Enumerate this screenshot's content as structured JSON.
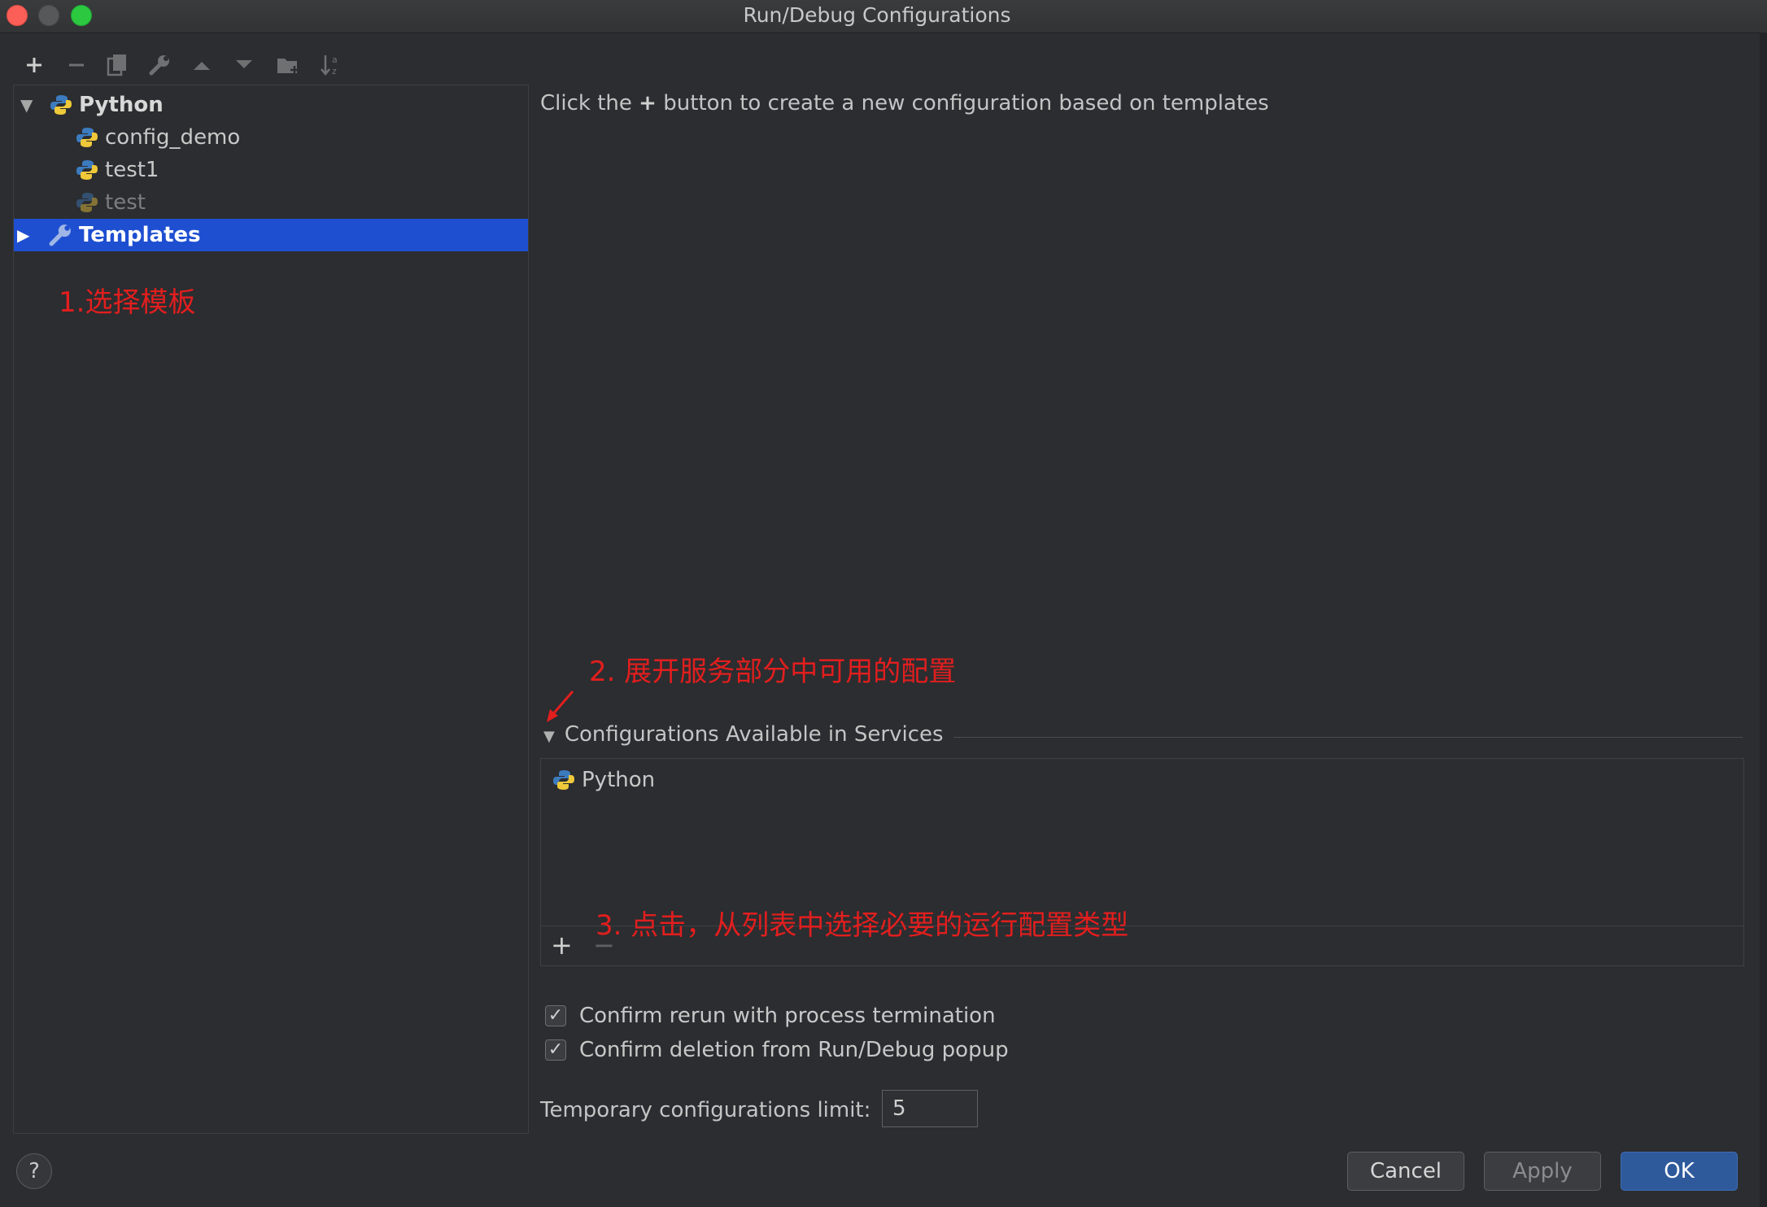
{
  "window": {
    "title": "Run/Debug Configurations"
  },
  "toolbar": {
    "buttons": [
      {
        "icon": "plus-icon",
        "enabled": true
      },
      {
        "icon": "minus-icon",
        "enabled": false
      },
      {
        "icon": "copy-icon",
        "enabled": false
      },
      {
        "icon": "wrench-icon",
        "enabled": false
      },
      {
        "icon": "arrow-up-icon",
        "enabled": false
      },
      {
        "icon": "arrow-down-icon",
        "enabled": false
      },
      {
        "icon": "folder-add-icon",
        "enabled": false
      },
      {
        "icon": "sort-alpha-icon",
        "enabled": false
      }
    ]
  },
  "tree": {
    "python_label": "Python",
    "children": [
      "config_demo",
      "test1",
      "test"
    ],
    "templates_label": "Templates"
  },
  "annotations": {
    "step1": "1.选择模板",
    "step2": "2. 展开服务部分中可用的配置",
    "step3": "3. 点击，从列表中选择必要的运行配置类型"
  },
  "main": {
    "hint_before": "Click the",
    "hint_plus": "+",
    "hint_after": "button to create a new configuration based on templates",
    "services_header": "Configurations Available in Services",
    "services_item": "Python",
    "services_add": "+",
    "services_remove": "−",
    "confirm_rerun": "Confirm rerun with process termination",
    "confirm_deletion": "Confirm deletion from Run/Debug popup",
    "limit_label": "Temporary configurations limit:",
    "limit_value": "5"
  },
  "buttons": {
    "help": "?",
    "cancel": "Cancel",
    "apply": "Apply",
    "ok": "OK"
  },
  "colors": {
    "accent": "#1e4fd1",
    "annotation": "#e21e1e",
    "background": "#2b2d30"
  }
}
